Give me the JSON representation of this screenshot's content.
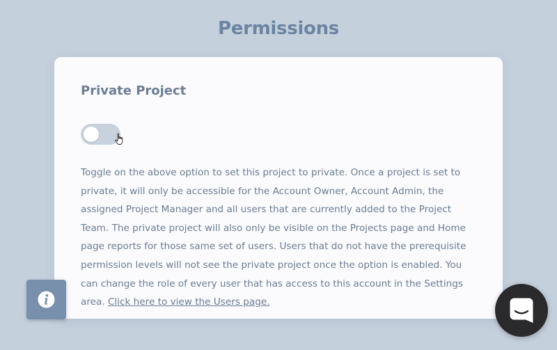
{
  "page": {
    "title": "Permissions"
  },
  "private_project": {
    "title": "Private Project",
    "toggle_state": "off",
    "description": "Toggle on the above option to set this project to private. Once a project is set to private, it will only be accessible for the Account Owner, Account Admin, the assigned Project Manager and all users that are currently added to the Project Team. The private project will also only be visible on the Projects page and Home page reports for those same set of users. Users that do not have the prerequisite permission levels will not see the private project once the option is enabled. You can change the role of every user that has access to this account in the Settings area. ",
    "users_link": "Click here to view the Users page."
  },
  "widgets": {
    "info_icon": "info-icon",
    "chat_icon": "chat-icon"
  },
  "colors": {
    "background": "#c5d0dd",
    "card": "#fbfbfd",
    "title": "#6c84a1",
    "text": "#6a7c92",
    "toggle_off": "#c7d2de",
    "info_button": "#7890ab",
    "chat_button": "#2a2a2d"
  }
}
